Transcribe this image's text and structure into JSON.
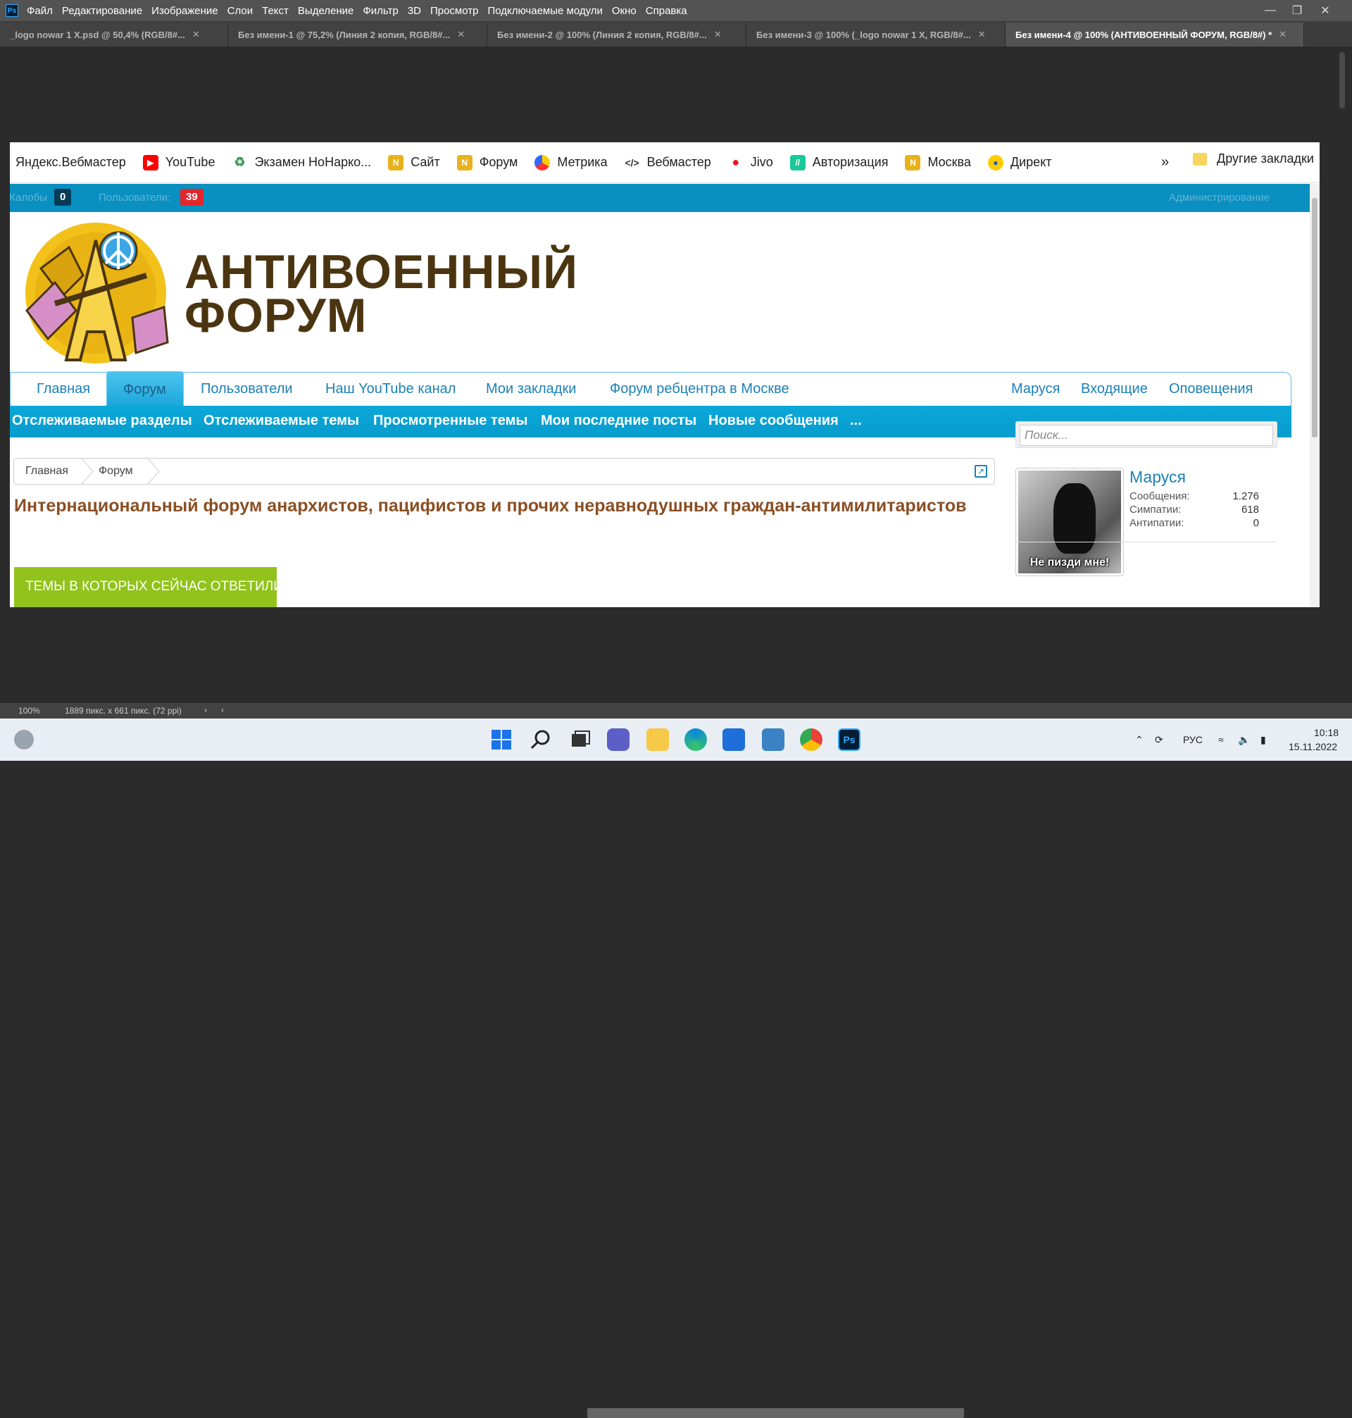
{
  "photoshop": {
    "logo_text": "Ps",
    "menu": [
      "Файл",
      "Редактирование",
      "Изображение",
      "Слои",
      "Текст",
      "Выделение",
      "Фильтр",
      "3D",
      "Просмотр",
      "Подключаемые модули",
      "Окно",
      "Справка"
    ],
    "tabs": [
      {
        "label": "_logo nowar 1 X.psd @ 50,4% (RGB/8#...",
        "active": false
      },
      {
        "label": "Без имени-1 @ 75,2% (Линия 2 копия, RGB/8#...",
        "active": false
      },
      {
        "label": "Без имени-2 @ 100% (Линия 2 копия, RGB/8#...",
        "active": false
      },
      {
        "label": "Без имени-3 @ 100% (_logo nowar 1 X, RGB/8#...",
        "active": false
      },
      {
        "label": "Без имени-4 @ 100% (АНТИВОЕННЫЙ ФОРУМ, RGB/8#) *",
        "active": true
      }
    ],
    "zoom": "100%",
    "doc_info": "1889 пикс. x 661 пикс. (72 ppi)"
  },
  "bookmarks": {
    "items": [
      {
        "label": "Яндекс.Вебмастер",
        "icon": "none"
      },
      {
        "label": "YouTube",
        "icon": "youtube-icon"
      },
      {
        "label": "Экзамен НоНарко...",
        "icon": "recycle-icon"
      },
      {
        "label": "Сайт",
        "icon": "site-logo-icon"
      },
      {
        "label": "Форум",
        "icon": "forum-logo-icon"
      },
      {
        "label": "Метрика",
        "icon": "metrika-icon"
      },
      {
        "label": "Вебмастер",
        "icon": "webmaster-icon"
      },
      {
        "label": "Jivo",
        "icon": "jivo-icon"
      },
      {
        "label": "Авторизация",
        "icon": "auth-icon"
      },
      {
        "label": "Москва",
        "icon": "moscow-logo-icon"
      },
      {
        "label": "Директ",
        "icon": "direct-icon"
      }
    ],
    "more": "»",
    "other": "Другие закладки"
  },
  "admin_bar": {
    "complaints_label": "Жалобы",
    "complaints_count": "0",
    "users_label": "Пользователи:",
    "users_count": "39",
    "admin_link": "Администрирование"
  },
  "header": {
    "title_line1": "АНТИВОЕННЫЙ",
    "title_line2": "ФОРУМ"
  },
  "nav": {
    "left": [
      "Главная",
      "Форум",
      "Пользователи",
      "Наш YouTube канал",
      "Мои закладки",
      "Форум ребцентра в Москве"
    ],
    "right": [
      "Маруся",
      "Входящие",
      "Оповещения"
    ],
    "active": "Форум"
  },
  "subnav": [
    "Отслеживаемые разделы",
    "Отслеживаемые темы",
    "Просмотренные темы",
    "Мои последние посты",
    "Новые сообщения",
    "..."
  ],
  "search": {
    "placeholder": "Поиск..."
  },
  "breadcrumb": [
    "Главная",
    "Форум"
  ],
  "forum_description": "Интернациональный форум анархистов, пацифистов и прочих неравнодушных граждан-антимилитаристов",
  "green_button": "ТЕМЫ В КОТОРЫХ СЕЙЧАС ОТВЕТИЛИ",
  "user": {
    "name": "Маруся",
    "avatar_caption": "Не пизди мне!",
    "stats": [
      {
        "label": "Сообщения:",
        "value": "1.276"
      },
      {
        "label": "Симпатии:",
        "value": "618"
      },
      {
        "label": "Антипатии:",
        "value": "0"
      }
    ]
  },
  "taskbar": {
    "lang": "РУС",
    "time": "10:18",
    "date": "15.11.2022"
  },
  "colors": {
    "accent_blue": "#0a8fc1",
    "title_brown": "#4b3510",
    "green": "#91c31c"
  }
}
